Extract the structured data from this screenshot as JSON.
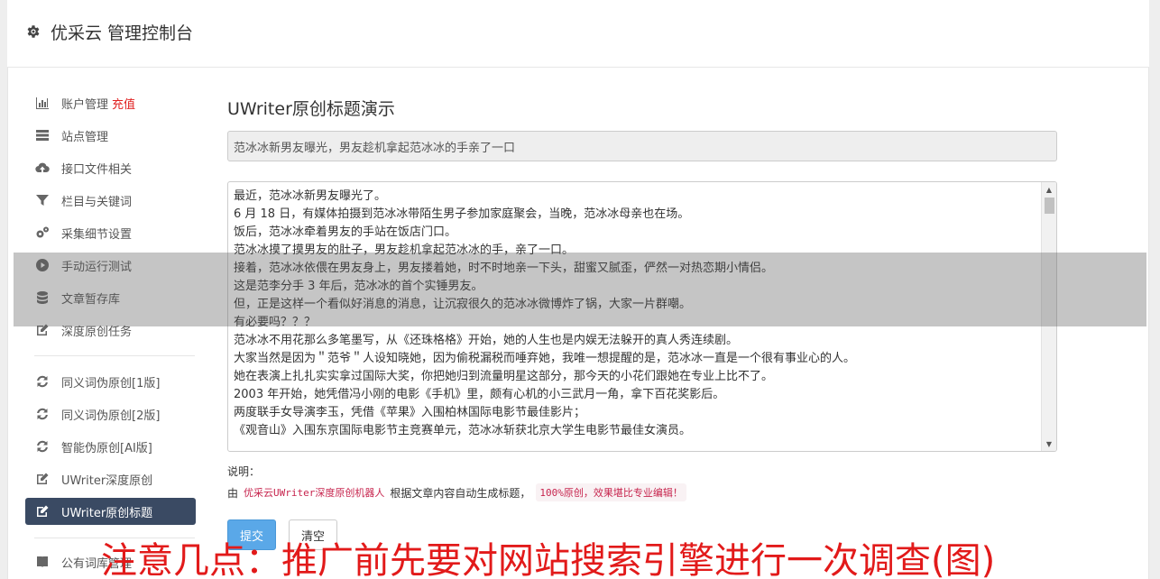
{
  "header": {
    "title": "优采云 管理控制台"
  },
  "sidebar": {
    "items": [
      {
        "label": "账户管理",
        "badge": "充值",
        "icon": "bar-chart-icon"
      },
      {
        "label": "站点管理",
        "icon": "server-icon"
      },
      {
        "label": "接口文件相关",
        "icon": "cloud-upload-icon"
      },
      {
        "label": "栏目与关键词",
        "icon": "filter-icon"
      },
      {
        "label": "采集细节设置",
        "icon": "cogs-icon"
      },
      {
        "label": "手动运行测试",
        "icon": "play-circle-icon"
      },
      {
        "label": "文章暂存库",
        "icon": "database-icon"
      },
      {
        "label": "深度原创任务",
        "icon": "edit-icon"
      },
      {
        "label": "同义词伪原创[1版]",
        "icon": "refresh-icon"
      },
      {
        "label": "同义词伪原创[2版]",
        "icon": "refresh-icon"
      },
      {
        "label": "智能伪原创[AI版]",
        "icon": "refresh-icon"
      },
      {
        "label": "UWriter深度原创",
        "icon": "edit-icon"
      },
      {
        "label": "UWriter原创标题",
        "icon": "edit-icon"
      },
      {
        "label": "公有词库管理",
        "icon": "book-icon"
      }
    ]
  },
  "main": {
    "title": "UWriter原创标题演示",
    "title_value": "范冰冰新男友曝光，男友趁机拿起范冰冰的手亲了一口",
    "content_lines": [
      "最近，范冰冰新男友曝光了。",
      "6 月 18 日，有媒体拍摄到范冰冰带陌生男子参加家庭聚会，当晚，范冰冰母亲也在场。",
      "饭后，范冰冰牵着男友的手站在饭店门口。",
      "范冰冰摸了摸男友的肚子，男友趁机拿起范冰冰的手，亲了一口。",
      "接着，范冰冰依偎在男友身上，男友搂着她，时不时地亲一下头，甜蜜又腻歪，俨然一对热恋期小情侣。",
      "这是范李分手 3 年后，范冰冰的首个实锤男友。",
      "但，正是这样一个看似好消息的消息，让沉寂很久的范冰冰微博炸了锅，大家一片群嘲。",
      "有必要吗？？？",
      "范冰冰不用花那么多笔墨写，从《还珠格格》开始，她的人生也是内娱无法躲开的真人秀连续剧。",
      "大家当然是因为＂范爷＂人设知晓她，因为偷税漏税而唾弃她，我唯一想提醒的是，范冰冰一直是一个很有事业心的人。",
      "她在表演上扎扎实实拿过国际大奖，你把她归到流量明星这部分，那今天的小花们跟她在专业上比不了。",
      "2003 年开始，她凭借冯小刚的电影《手机》里，颇有心机的小三武月一角，拿下百花奖影后。",
      "两度联手女导演李玉，凭借《苹果》入围柏林国际电影节最佳影片；",
      "《观音山》入围东京国际电影节主竞赛单元，范冰冰斩获北京大学生电影节最佳女演员。"
    ],
    "note_label": "说明：",
    "note_prefix": "由",
    "note_code": "优采云UWriter深度原创机器人",
    "note_mid": "根据文章内容自动生成标题，",
    "note_box": "100%原创，效果堪比专业编辑！",
    "submit_label": "提交",
    "clear_label": "清空"
  },
  "watermark": "注意几点：推广前先要对网站搜索引擎进行一次调查(图)",
  "colors": {
    "active_nav": "#3a4a63",
    "badge": "#e02020",
    "submit": "#5aa8e8",
    "watermark": "#e21a1a"
  }
}
